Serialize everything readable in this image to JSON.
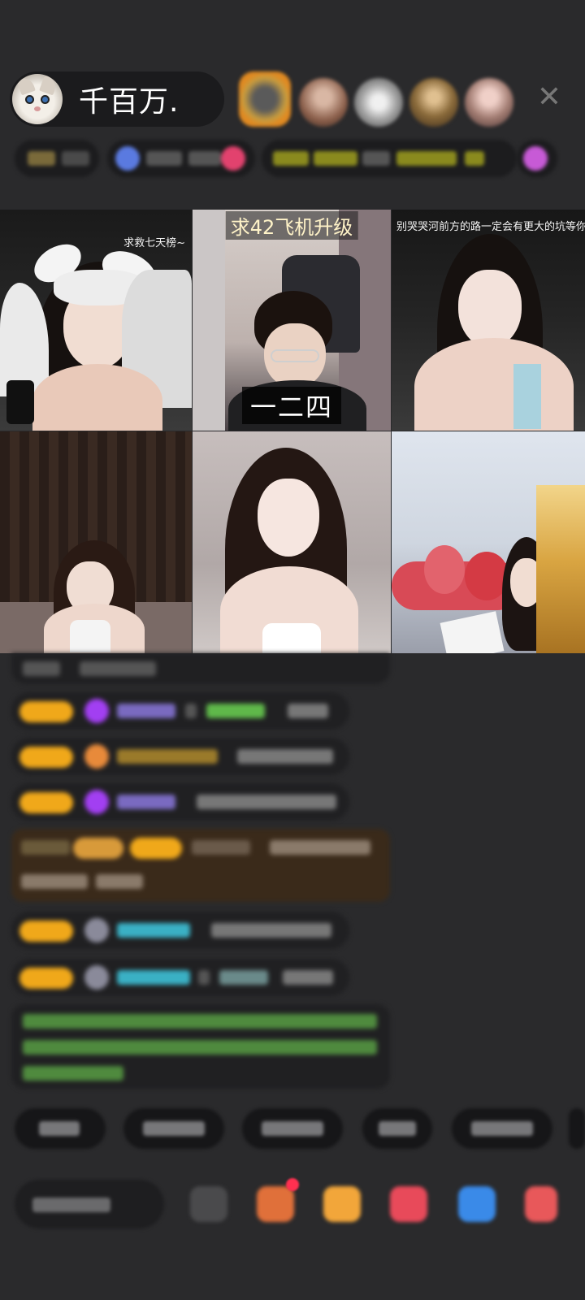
{
  "host": {
    "name": "千百万."
  },
  "viewers": [
    "viewer-1",
    "viewer-2",
    "viewer-3",
    "viewer-4",
    "viewer-5"
  ],
  "icons": {
    "close": "close-icon",
    "avatar": "cat-avatar"
  },
  "grid": {
    "tiles": [
      {
        "caption": "求救七天榜~"
      },
      {
        "caption_top": "求42飞机升级",
        "caption_bottom": "一二四"
      },
      {
        "caption": "别哭哭河前方的路一定会有更大的坑等你"
      },
      {
        "caption": ""
      },
      {
        "caption": ""
      },
      {
        "caption": ""
      }
    ]
  },
  "colors": {
    "background": "#2a2a2c",
    "badge": "#f0a81a",
    "gem": "#a23ff2",
    "chat_green": "#5fb84a",
    "chat_cyan": "#3ab0c4"
  }
}
